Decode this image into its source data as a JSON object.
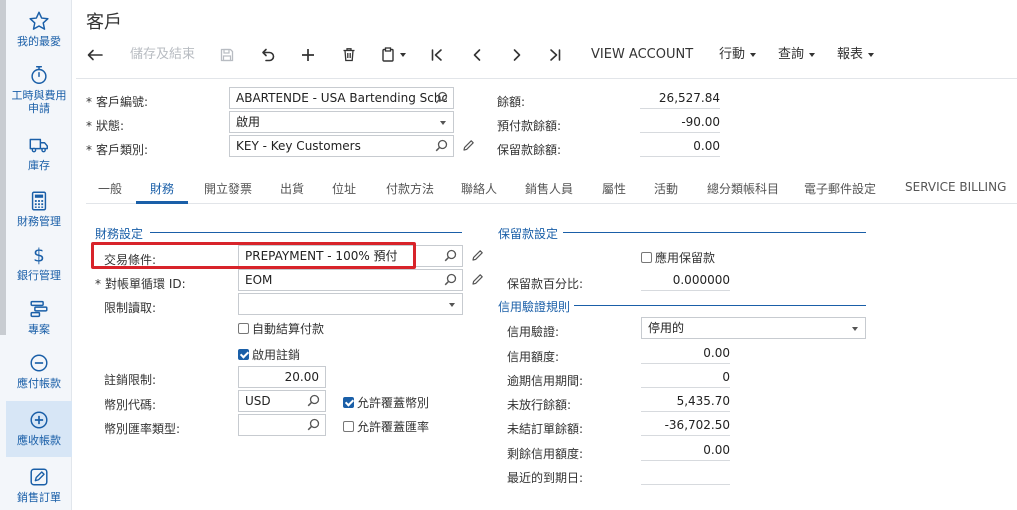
{
  "nav": {
    "items": [
      {
        "label_1": "我的最愛",
        "label_2": "",
        "icon": "star-icon"
      },
      {
        "label_1": "工時與費用",
        "label_2": "申請",
        "icon": "stopwatch-icon"
      },
      {
        "label_1": "庫存",
        "label_2": "",
        "icon": "truck-icon"
      },
      {
        "label_1": "財務管理",
        "label_2": "",
        "icon": "calculator-icon"
      },
      {
        "label_1": "銀行管理",
        "label_2": "",
        "icon": "dollar-icon"
      },
      {
        "label_1": "專案",
        "label_2": "",
        "icon": "project-icon"
      },
      {
        "label_1": "應付帳款",
        "label_2": "",
        "icon": "minus-circle-icon"
      },
      {
        "label_1": "應收帳款",
        "label_2": "",
        "icon": "plus-circle-icon"
      },
      {
        "label_1": "銷售訂單",
        "label_2": "",
        "icon": "edit-icon"
      }
    ],
    "active_index": 7,
    "accent": "#1a5fa8"
  },
  "page": {
    "title": "客戶"
  },
  "toolbar": {
    "save_close": "儲存及結束",
    "view_account": "VIEW ACCOUNT",
    "actions": "行動",
    "inquiries": "查詢",
    "reports": "報表"
  },
  "header": {
    "customer_id_label": "客戶編號:",
    "customer_id_value": "ABARTENDE - USA Bartending Schoo",
    "status_label": "狀態:",
    "status_value": "啟用",
    "class_label": "客戶類別:",
    "class_value": "KEY - Key Customers",
    "balance_label": "餘額:",
    "balance_value": "26,527.84",
    "prepay_label": "預付款餘額:",
    "prepay_value": "-90.00",
    "retained_label": "保留款餘額:",
    "retained_value": "0.00"
  },
  "tabs": [
    "一般",
    "財務",
    "開立發票",
    "出貨",
    "位址",
    "付款方法",
    "聯絡人",
    "銷售人員",
    "屬性",
    "活動",
    "總分類帳科目",
    "電子郵件設定",
    "SERVICE BILLING"
  ],
  "active_tab_index": 1,
  "financial": {
    "section_title": "財務設定",
    "terms_label": "交易條件:",
    "terms_value": "PREPAYMENT - 100% 預付",
    "stmt_cycle_label": "對帳單循環 ID:",
    "stmt_cycle_value": "EOM",
    "restrict_label": "限制讀取:",
    "restrict_value": "",
    "auto_apply_label": "自動結算付款",
    "auto_apply_checked": false,
    "enable_writeoff_label": "啟用註銷",
    "enable_writeoff_checked": true,
    "writeoff_limit_label": "註銷限制:",
    "writeoff_limit_value": "20.00",
    "currency_label": "幣別代碼:",
    "currency_value": "USD",
    "allow_override_currency_label": "允許覆蓋幣別",
    "allow_override_currency_checked": true,
    "rate_type_label": "幣別匯率類型:",
    "rate_type_value": "",
    "allow_override_rate_label": "允許覆蓋匯率",
    "allow_override_rate_checked": false
  },
  "retainage": {
    "section_title": "保留款設定",
    "apply_label": "應用保留款",
    "apply_checked": false,
    "pct_label": "保留款百分比:",
    "pct_value": "0.000000"
  },
  "credit": {
    "section_title": "信用驗證規則",
    "verification_label": "信用驗證:",
    "verification_value": "停用的",
    "limit_label": "信用額度:",
    "limit_value": "0.00",
    "overdue_label": "逾期信用期間:",
    "overdue_value": "0",
    "open_orders_label": "未放行餘額:",
    "open_orders_value": "5,435.70",
    "unreleased_label": "未結訂單餘額:",
    "unreleased_value": "-36,702.50",
    "remaining_label": "剩餘信用額度:",
    "remaining_value": "0.00",
    "first_due_label": "最近的到期日:",
    "first_due_value": ""
  }
}
